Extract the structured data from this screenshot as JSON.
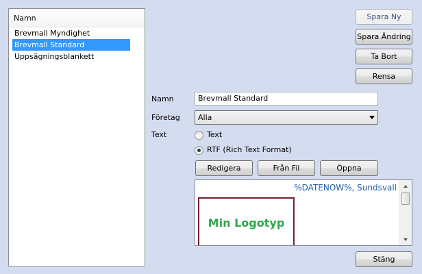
{
  "list": {
    "header": "Namn",
    "items": [
      "Brevmall Myndighet",
      "Brevmall Standard",
      "Uppsägningsblankett"
    ],
    "selected_index": 1
  },
  "buttons": {
    "spara_ny": "Spara Ny",
    "spara_andring": "Spara Ändring",
    "ta_bort": "Ta Bort",
    "rensa": "Rensa",
    "stang": "Stäng",
    "redigera": "Redigera",
    "fran_fil": "Från Fil",
    "oppna": "Öppna"
  },
  "form": {
    "namn_label": "Namn",
    "namn_value": "Brevmall Standard",
    "foretag_label": "Företag",
    "foretag_value": "Alla",
    "text_label": "Text",
    "radio_text_label": "Text",
    "radio_rtf_label": "RTF (Rich Text Format)",
    "selected_radio": "rtf"
  },
  "preview": {
    "date_line": "%DATENOW%, Sundsvall",
    "logo_text": "Min Logotyp"
  },
  "colors": {
    "background": "#d4dcf0",
    "selection": "#3399ff",
    "date_text": "#1f5fa8",
    "logo_text": "#2fa64a",
    "logo_border": "#7a1f2a"
  }
}
